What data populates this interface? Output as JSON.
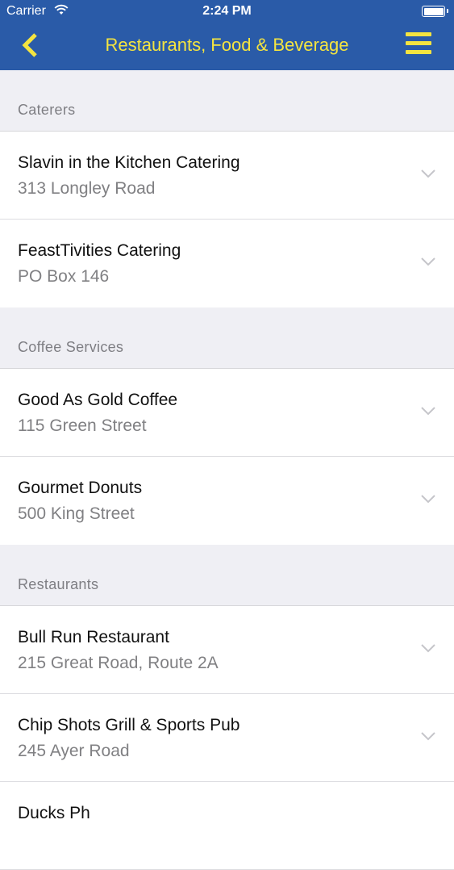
{
  "status_bar": {
    "carrier": "Carrier",
    "time": "2:24 PM"
  },
  "header": {
    "title": "Restaurants, Food & Beverage",
    "accent_color": "#f4e440",
    "bar_color": "#2a5ba8"
  },
  "sections": [
    {
      "title": "Caterers",
      "items": [
        {
          "name": "Slavin in the Kitchen Catering",
          "address": "313 Longley Road"
        },
        {
          "name": "FeastTivities Catering",
          "address": "PO Box 146"
        }
      ]
    },
    {
      "title": "Coffee Services",
      "items": [
        {
          "name": "Good As Gold Coffee",
          "address": "115 Green Street"
        },
        {
          "name": "Gourmet Donuts",
          "address": "500 King Street"
        }
      ]
    },
    {
      "title": "Restaurants",
      "items": [
        {
          "name": "Bull Run Restaurant",
          "address": "215 Great Road, Route 2A"
        },
        {
          "name": "Chip Shots Grill & Sports Pub",
          "address": "245 Ayer Road"
        },
        {
          "name": "Ducks Ph",
          "address": ""
        }
      ]
    }
  ]
}
